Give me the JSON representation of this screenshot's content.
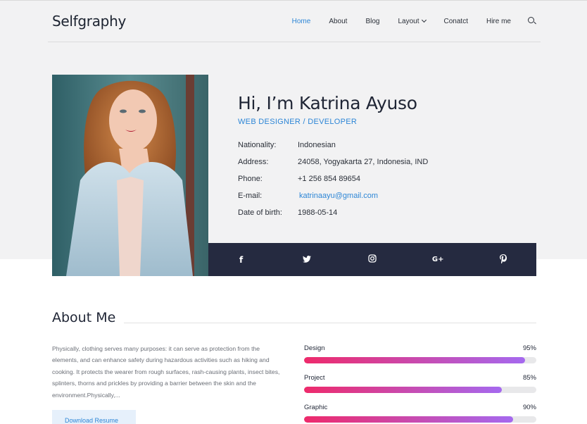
{
  "header": {
    "logo": "Selfgraphy",
    "nav": [
      {
        "label": "Home",
        "active": true
      },
      {
        "label": "About",
        "active": false
      },
      {
        "label": "Blog",
        "active": false
      },
      {
        "label": "Layout",
        "active": false,
        "has_dropdown": true
      },
      {
        "label": "Conatct",
        "active": false
      },
      {
        "label": "Hire me",
        "active": false
      }
    ],
    "search_icon": "search-icon"
  },
  "profile": {
    "greeting": "Hi, I’m Katrina Ayuso",
    "role": "WEB DESIGNER / DEVELOPER",
    "details": [
      {
        "label": "Nationality:",
        "value": "Indonesian"
      },
      {
        "label": "Address:",
        "value": "24058, Yogyakarta 27, Indonesia, IND"
      },
      {
        "label": "Phone:",
        "value": "+1 256 854 89654"
      },
      {
        "label": "E-mail:",
        "value": "katrinaayu@gmail.com",
        "is_link": true
      },
      {
        "label": "Date of birth:",
        "value": "1988-05-14"
      }
    ],
    "photo_icon": "profile-photo"
  },
  "social": [
    {
      "icon": "facebook-icon",
      "glyph": "f"
    },
    {
      "icon": "twitter-icon",
      "glyph": "t"
    },
    {
      "icon": "instagram-icon",
      "glyph": "◎"
    },
    {
      "icon": "google-plus-icon",
      "glyph": "G+"
    },
    {
      "icon": "pinterest-icon",
      "glyph": "p"
    }
  ],
  "about": {
    "title": "About Me",
    "text": "Physically, clothing serves many purposes: it can serve as protection from the elements, and can enhance safety during hazardous activities such as hiking and cooking. It protects the wearer from rough surfaces, rash-causing plants, insect bites, splinters, thorns and prickles by providing a barrier between the skin and the environment.Physically,...",
    "button_label": "Download Resume"
  },
  "skills": [
    {
      "name": "Design",
      "percent_label": "95%",
      "percent": 95
    },
    {
      "name": "Project",
      "percent_label": "85%",
      "percent": 85
    },
    {
      "name": "Graphic",
      "percent_label": "90%",
      "percent": 90
    }
  ],
  "colors": {
    "accent": "#2d86d6",
    "social_bar": "#252a40",
    "skill_gradient_start": "#ee2a6b",
    "skill_gradient_end": "#a569ef"
  }
}
